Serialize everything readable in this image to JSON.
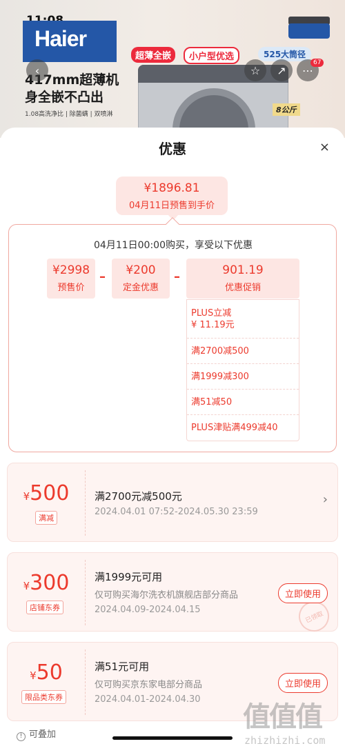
{
  "status": {
    "time": "11:08"
  },
  "banner": {
    "brand": "Haier",
    "headline": "417mm超薄机身全嵌不凸出",
    "subline": "1.08高洗净比 | 除菌螨 | 双喷淋",
    "tag1": "超薄全嵌",
    "tag2": "小户型优选",
    "tag3": "525大筒径",
    "capacity": "8公斤",
    "cart_count": "67",
    "icons": {
      "back": "back-icon",
      "favorite": "star-icon",
      "share": "share-icon",
      "cart": "cart-icon"
    }
  },
  "sheet": {
    "title": "优惠",
    "close": "×",
    "final_price": "¥1896.81",
    "final_label": "04月11日预售到手价",
    "caption": "04月11日00:00购买，享受以下优惠",
    "presale": {
      "value": "¥2998",
      "label": "预售价"
    },
    "deposit": {
      "value": "¥200",
      "label": "定金优惠"
    },
    "promo": {
      "value": "901.19",
      "label": "优惠促销"
    },
    "minus": "–",
    "promos": [
      {
        "line1": "PLUS立减",
        "line2": "¥ 11.19元"
      },
      {
        "line1": "满2700减500"
      },
      {
        "line1": "满1999减300"
      },
      {
        "line1": "满51减50"
      },
      {
        "line1": "PLUS津贴满499减40"
      }
    ]
  },
  "coupons": [
    {
      "symbol": "¥",
      "amount": "500",
      "type": "满减",
      "condition": "满2700元减500元",
      "date": "2024.04.01 07:52-2024.05.30 23:59",
      "chevron": "›"
    },
    {
      "symbol": "¥",
      "amount": "300",
      "type": "店铺东券",
      "condition": "满1999元可用",
      "scope": "仅可购买海尔洗衣机旗舰店部分商品",
      "date": "2024.04.09-2024.04.15",
      "button": "立即使用",
      "stamp": "已领取"
    },
    {
      "symbol": "¥",
      "amount": "50",
      "type": "限品类东券",
      "condition": "满51元可用",
      "scope": "仅可购买京东家电部分商品",
      "date": "2024.04.01-2024.04.30",
      "button": "立即使用"
    }
  ],
  "footer": {
    "stack_icon": "!",
    "stack_note": "可叠加"
  },
  "watermark": {
    "glyphs": "值值值",
    "site": "zhizhizhi.com"
  },
  "colors": {
    "accent": "#ec3a2d",
    "accent_light": "#fde6e3",
    "card_bg": "#fef4f2"
  }
}
